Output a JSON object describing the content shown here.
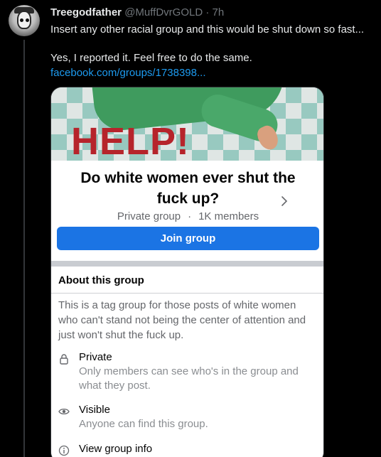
{
  "tweet": {
    "author_name": "Treegodfather",
    "handle": "@MuffDvrGOLD",
    "separator": "·",
    "time": "7h",
    "line1": "Insert any other racial group and this would be shut down so fast...",
    "line2": "Yes, I reported it. Feel free to do the same.",
    "link": "facebook.com/groups/1738398..."
  },
  "card": {
    "cover_text": "HELP!",
    "group_title": "Do white women ever shut the fuck up?",
    "privacy": "Private group",
    "meta_sep": "·",
    "members": "1K members",
    "join_label": "Join group",
    "about_title": "About this group",
    "about_desc": "This is a tag group for those posts of white women who can't stand not being the center of attention and just won't shut the fuck up.",
    "private_label": "Private",
    "private_sub": "Only members can see who's in the group and what they post.",
    "visible_label": "Visible",
    "visible_sub": "Anyone can find this group.",
    "info_label": "View group info"
  },
  "colors": {
    "link": "#1d9bf0",
    "join_button": "#1b74e4",
    "help_red": "#b6242b"
  },
  "icons": [
    "avatar",
    "chevron-right-icon",
    "lock-icon",
    "eye-icon",
    "info-icon"
  ]
}
